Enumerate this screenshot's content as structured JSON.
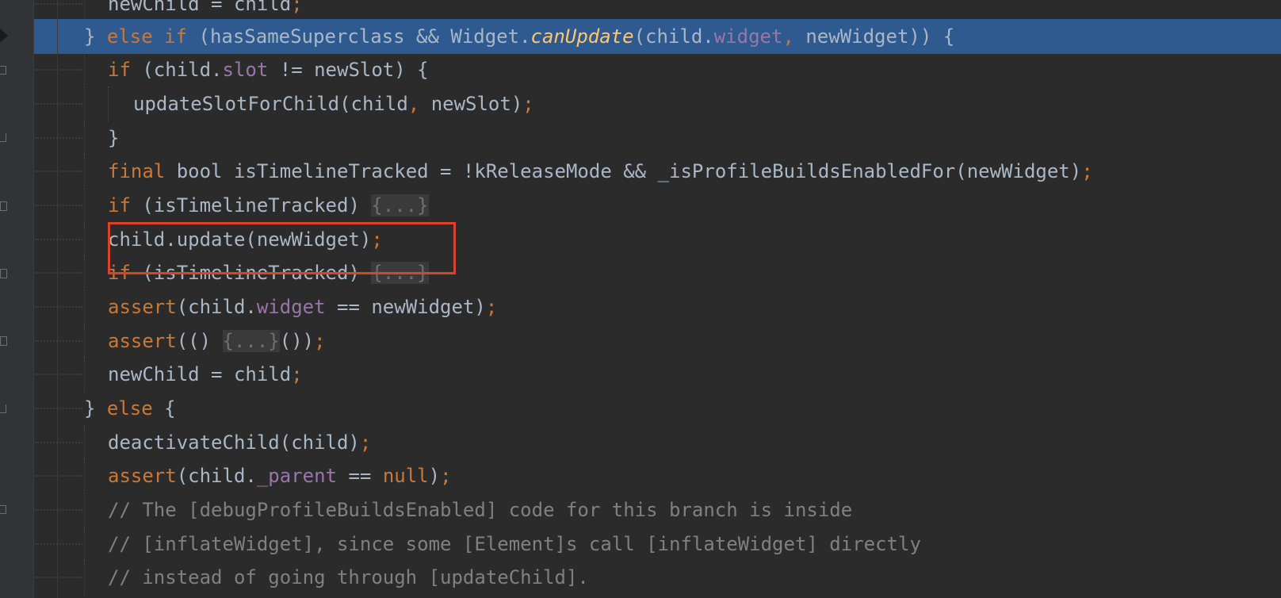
{
  "editor": {
    "language": "Dart",
    "colors": {
      "background": "#2b2b2b",
      "current_line": "#2f5a8f",
      "keyword": "#cc7832",
      "field": "#9876aa",
      "method_call": "#ffc66d",
      "comment": "#808080",
      "text": "#a9b7c6",
      "annotation_box": "#d9432c"
    },
    "lines": [
      {
        "a": "newChild = child",
        "b": ";"
      },
      {
        "a": "} ",
        "b": "else if ",
        "c": "(hasSameSuperclass && Widget.",
        "d": "canUpdate",
        "e": "(child.",
        "f": "widget",
        "g": ", ",
        "h": "newWidget)) {"
      },
      {
        "a": "if ",
        "b": "(child.",
        "c": "slot",
        "d": " != newSlot) {"
      },
      {
        "a": "updateSlotForChild(child",
        "b": ", ",
        "c": "newSlot)",
        "d": ";"
      },
      {
        "a": "}"
      },
      {
        "a": "final ",
        "b": "bool isTimelineTracked = !kReleaseMode && _isProfileBuildsEnabledFor(newWidget)",
        "c": ";"
      },
      {
        "a": "if ",
        "b": "(isTimelineTracked) ",
        "c": "{...}"
      },
      {
        "a": "child.update(newWidget)",
        "b": ";"
      },
      {
        "a": "if ",
        "b": "(isTimelineTracked) ",
        "c": "{...}"
      },
      {
        "a": "assert",
        "b": "(child.",
        "c": "widget",
        "d": " == newWidget)",
        "e": ";"
      },
      {
        "a": "assert",
        "b": "(() ",
        "c": "{...}",
        "d": "())",
        "e": ";"
      },
      {
        "a": "newChild = child",
        "b": ";"
      },
      {
        "a": "} ",
        "b": "else ",
        "c": "{"
      },
      {
        "a": "deactivateChild(child)",
        "b": ";"
      },
      {
        "a": "assert",
        "b": "(child.",
        "c": "_parent",
        "d": " == ",
        "e": "null",
        "f": ")",
        "g": ";"
      },
      {
        "a": "// The [debugProfileBuildsEnabled] code for this branch is inside"
      },
      {
        "a": "// [inflateWidget], since some [Element]s call [inflateWidget] directly"
      },
      {
        "a": "// instead of going through [updateChild]."
      }
    ]
  }
}
